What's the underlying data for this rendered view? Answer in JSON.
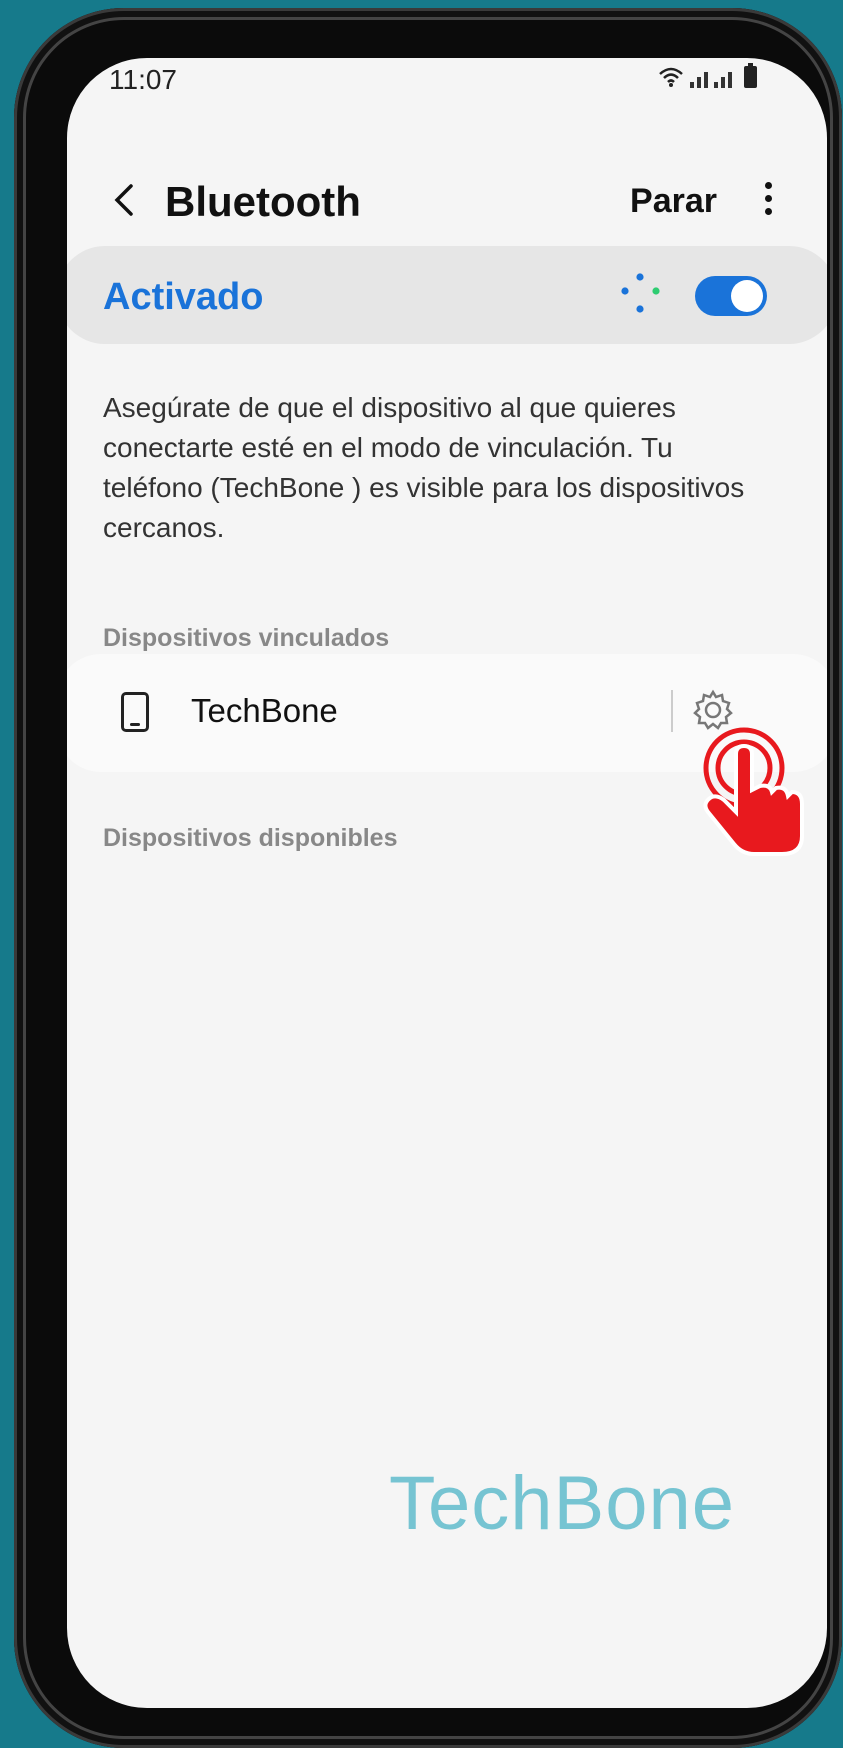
{
  "status_bar": {
    "time": "11:07",
    "icons": [
      "wifi-icon",
      "signal-icon",
      "signal-icon",
      "battery-icon"
    ]
  },
  "header": {
    "title": "Bluetooth",
    "stop_label": "Parar",
    "back_icon": "chevron-left-icon",
    "more_icon": "more-vertical-icon"
  },
  "toggle": {
    "label": "Activado",
    "state": true,
    "accent": "#1a73d9"
  },
  "description": "Asegúrate de que el dispositivo al que quieres conectarte esté en el modo de vinculación. Tu teléfono (TechBone ) es visible para los dispositivos cercanos.",
  "paired_section": {
    "label": "Dispositivos vinculados"
  },
  "paired_devices": [
    {
      "name": "TechBone",
      "icon": "phone-icon",
      "settings_icon": "gear-icon"
    }
  ],
  "available_section": {
    "label": "Dispositivos disponibles"
  },
  "watermark": "TechBone",
  "tap_indicator": {
    "icon": "tap-hand-icon",
    "color": "#e8191e"
  }
}
